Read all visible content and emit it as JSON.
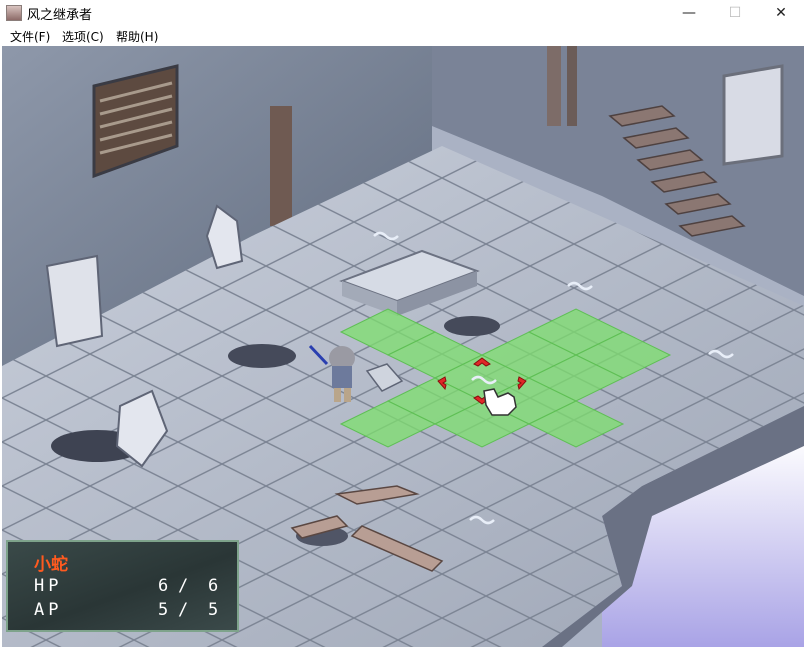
{
  "window": {
    "title": "风之继承者",
    "controls": {
      "minimize": "—",
      "maximize": "☐",
      "close": "✕"
    }
  },
  "menu": {
    "items": [
      {
        "label": "文件(F)"
      },
      {
        "label": "选项(C)"
      },
      {
        "label": "帮助(H)"
      }
    ]
  },
  "status": {
    "unit_name": "小蛇",
    "hp": {
      "label": "HP",
      "current": "6",
      "sep": "/",
      "max": "6"
    },
    "ap": {
      "label": "AP",
      "current": "5",
      "sep": "/",
      "max": "5"
    }
  },
  "colors": {
    "unit_name": "#ff5a1f",
    "move_range": "#7ee06e",
    "cursor": "#e02828",
    "status_border": "#7ea38b"
  },
  "icons": {
    "pointer": "hand-pointer-icon",
    "cursor": "target-cursor-icon"
  }
}
